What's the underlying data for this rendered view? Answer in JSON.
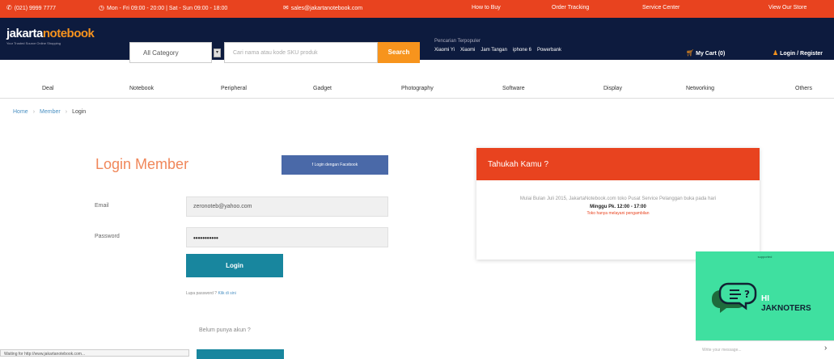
{
  "topbar": {
    "phone": "(021) 9999 7777",
    "hours": "Mon - Fri 09:00 - 20:00 | Sat - Sun 09:00 - 18:00",
    "email": "sales@jakartanotebook.com",
    "how_to_buy": "How to Buy",
    "order_tracking": "Order Tracking",
    "service_center": "Service Center",
    "view_store": "View Our Store"
  },
  "header": {
    "logo_white": "jakarta",
    "logo_orange": "notebook",
    "logo_tagline": "Your Trusted Source Online Shopping",
    "category": "All Category",
    "search_placeholder": "Cari nama atau kode SKU produk",
    "search_button": "Search",
    "popular_label": "Pencarian Terpopuler",
    "popular": [
      "Xiaomi Yi",
      "Xiaomi",
      "Jam Tangan",
      "iphone 6",
      "Powerbank"
    ],
    "cart": "My Cart (0)",
    "login": "Login / Register"
  },
  "nav": [
    "Deal",
    "Notebook",
    "Peripheral",
    "Gadget",
    "Photography",
    "Software",
    "Display",
    "Networking",
    "Others"
  ],
  "breadcrumb": {
    "home": "Home",
    "member": "Member",
    "current": "Login"
  },
  "login": {
    "title": "Login Member",
    "facebook_button": "Login dengan Facebook",
    "email_label": "Email",
    "email_value": "zeronoteb@yahoo.com",
    "password_label": "Password",
    "password_value": "•••••••••••",
    "login_button": "Login",
    "forgot_text": "Lupa password ?",
    "forgot_link": "Klik di sini",
    "no_account": "Belum punya akun ?"
  },
  "info": {
    "title": "Tahukah Kamu ?",
    "body": "Mulai Bulan Juli 2015, JakartaNotebook.com toko Pusat Service Pelanggan buka pada hari",
    "time": "Minggu Pk. 12:00 - 17:00",
    "note": "Toko hanya melayani pengambilan"
  },
  "chat": {
    "supported": "supported",
    "greeting": "HI",
    "name": "JAKNOTERS",
    "input_placeholder": "Write your message...",
    "send_icon": "send-icon"
  },
  "status_text": "Waiting for http://www.jakartanotebook.com..."
}
